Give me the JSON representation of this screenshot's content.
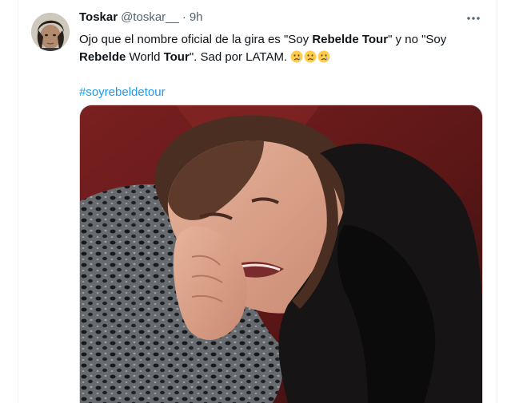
{
  "tweet": {
    "display_name": "Toskar",
    "handle": "@toskar__",
    "separator": "·",
    "time": "9h",
    "text": {
      "part1": "Ojo que el nombre oficial de la gira es \"Soy ",
      "bold1": "Rebelde Tour",
      "part2": "\" y no \"Soy ",
      "bold2": "Rebelde",
      "part3": " World ",
      "bold3": "Tour",
      "part4": "\". Sad por LATAM. "
    },
    "emojis": [
      "crying-face-emoji",
      "crying-face-emoji",
      "crying-face-emoji"
    ],
    "hashtag": "#soyrebeldetour"
  },
  "icons": {
    "more": "more-horizontal-icon"
  },
  "colors": {
    "link": "#1d9bf0",
    "text_primary": "#0f1419",
    "text_secondary": "#536471",
    "border": "#cfd9de"
  }
}
